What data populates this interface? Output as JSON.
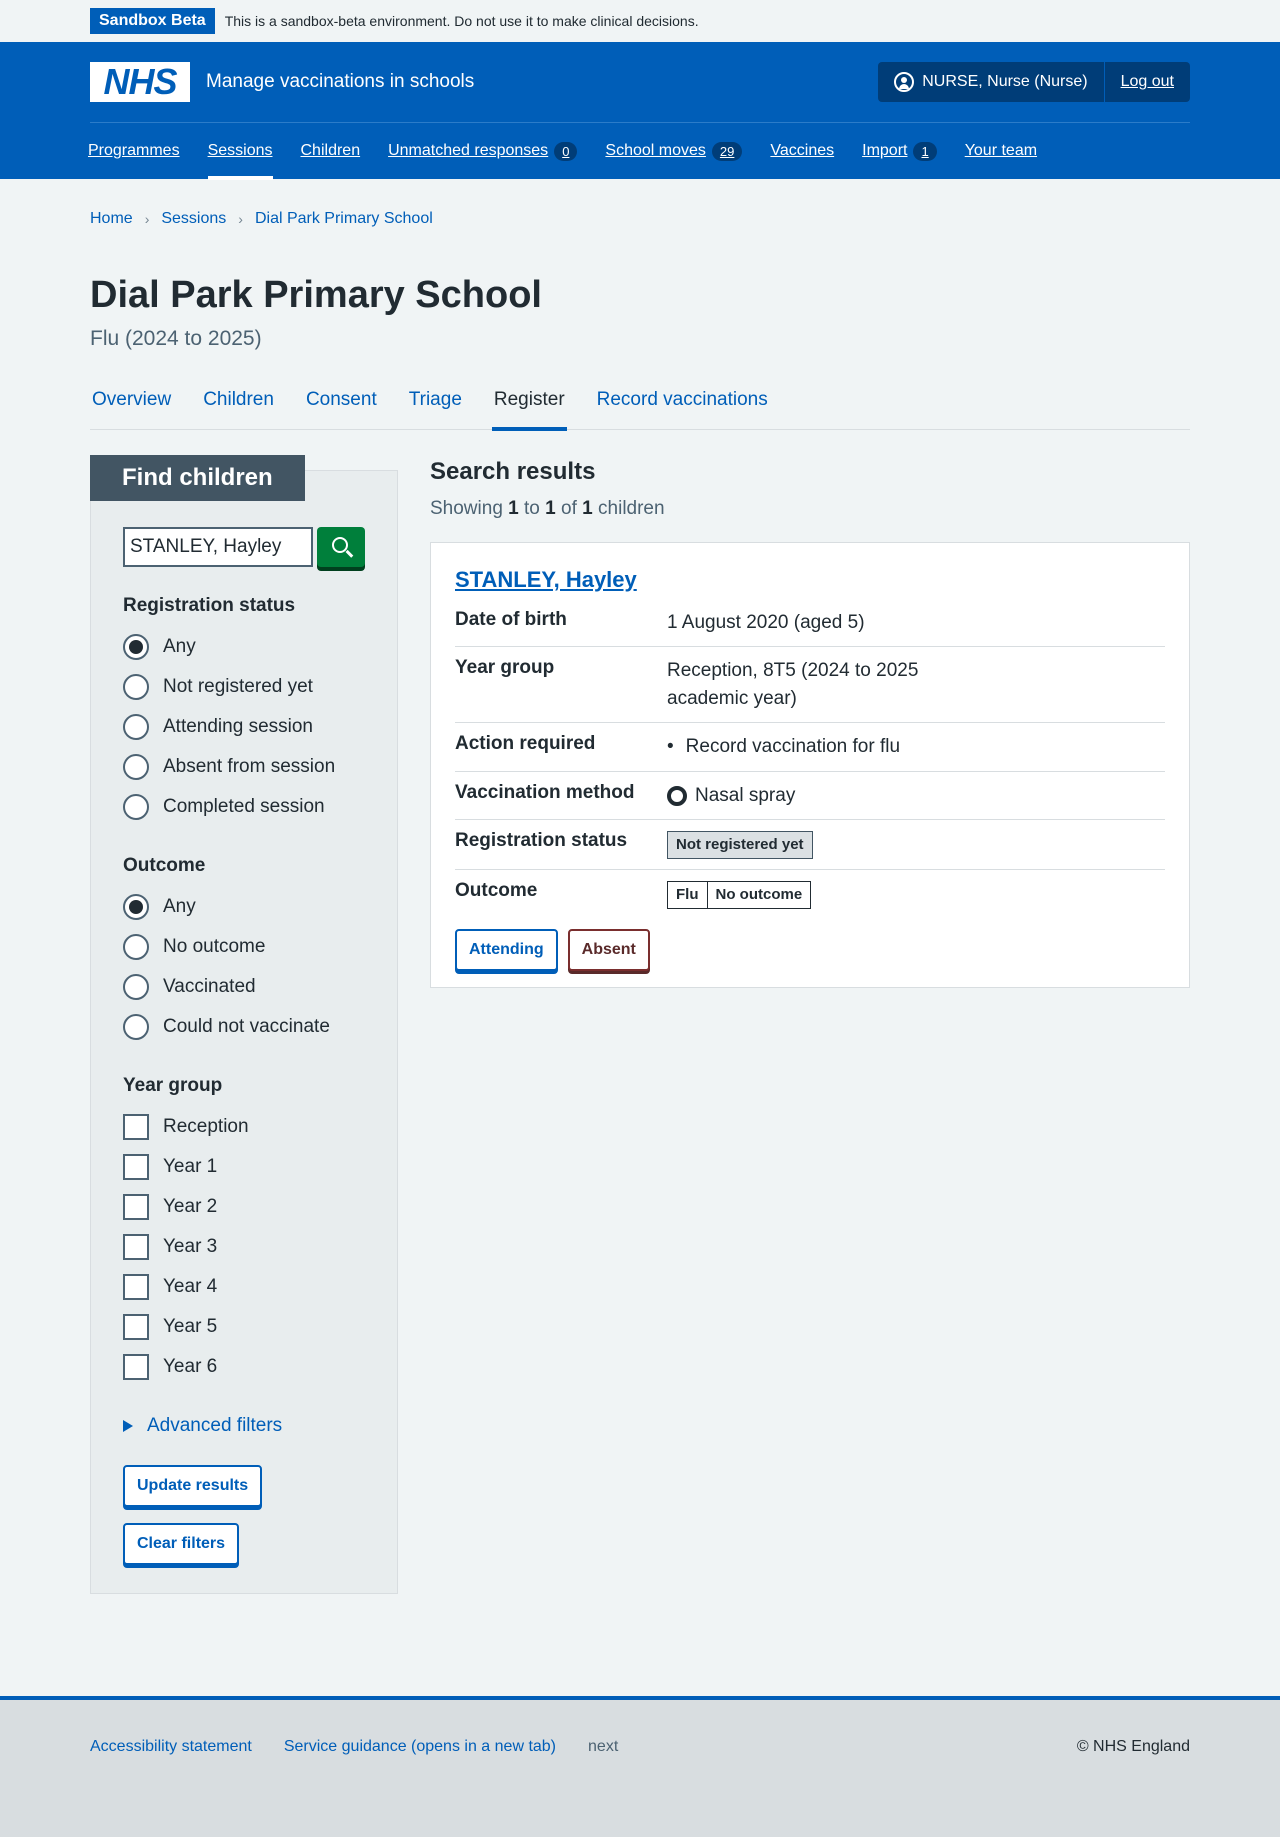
{
  "sandbox": {
    "tag": "Sandbox Beta",
    "text": "This is a sandbox-beta environment. Do not use it to make clinical decisions."
  },
  "header": {
    "logo": "NHS",
    "service_name": "Manage vaccinations in schools",
    "user": "NURSE, Nurse (Nurse)",
    "logout": "Log out",
    "nav": [
      {
        "label": "Programmes"
      },
      {
        "label": "Sessions"
      },
      {
        "label": "Children"
      },
      {
        "label": "Unmatched responses",
        "count": "0"
      },
      {
        "label": "School moves",
        "count": "29"
      },
      {
        "label": "Vaccines"
      },
      {
        "label": "Import",
        "count": "1"
      },
      {
        "label": "Your team"
      }
    ]
  },
  "breadcrumb": [
    "Home",
    "Sessions",
    "Dial Park Primary School"
  ],
  "page": {
    "title": "Dial Park Primary School",
    "caption": "Flu (2024 to 2025)"
  },
  "tabs": [
    "Overview",
    "Children",
    "Consent",
    "Triage",
    "Register",
    "Record vaccinations"
  ],
  "filters": {
    "heading": "Find children",
    "search_value": "STANLEY, Hayley",
    "registration": {
      "legend": "Registration status",
      "options": [
        "Any",
        "Not registered yet",
        "Attending session",
        "Absent from session",
        "Completed session"
      ]
    },
    "outcome": {
      "legend": "Outcome",
      "options": [
        "Any",
        "No outcome",
        "Vaccinated",
        "Could not vaccinate"
      ]
    },
    "year_group": {
      "legend": "Year group",
      "options": [
        "Reception",
        "Year 1",
        "Year 2",
        "Year 3",
        "Year 4",
        "Year 5",
        "Year 6"
      ]
    },
    "advanced": "Advanced filters",
    "update": "Update results",
    "clear": "Clear filters"
  },
  "results": {
    "heading": "Search results",
    "showing_prefix": "Showing",
    "from": "1",
    "to_word": "to",
    "to": "1",
    "of_word": "of",
    "total": "1",
    "suffix": "children",
    "child": {
      "name": "STANLEY, Hayley",
      "rows": {
        "dob_key": "Date of birth",
        "dob_val": "1 August 2020 (aged 5)",
        "year_key": "Year group",
        "year_val": "Reception, 8T5 (2024 to 2025 academic year)",
        "action_key": "Action required",
        "action_val": "Record vaccination for flu",
        "method_key": "Vaccination method",
        "method_val": "Nasal spray",
        "reg_key": "Registration status",
        "reg_val": "Not registered yet",
        "outcome_key": "Outcome",
        "outcome_prog": "Flu",
        "outcome_val": "No outcome"
      },
      "attending": "Attending",
      "absent": "Absent"
    }
  },
  "footer": {
    "accessibility": "Accessibility statement",
    "guidance": "Service guidance (opens in a new tab)",
    "version": "next",
    "copyright": "© NHS England"
  }
}
